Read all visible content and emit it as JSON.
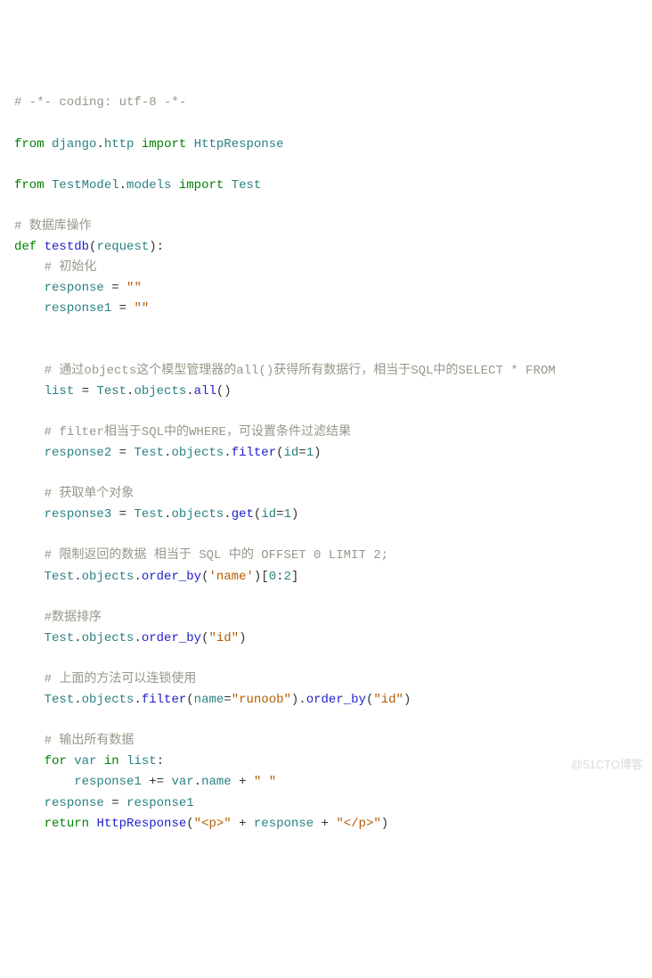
{
  "code": {
    "l1": {
      "c1": "# -*- coding: utf-8 -*-"
    },
    "l3": {
      "kw1": "from",
      "id1": "django",
      "op1": ".",
      "id2": "http",
      "kw2": "import",
      "id3": "HttpResponse"
    },
    "l5": {
      "kw1": "from",
      "id1": "TestModel",
      "op1": ".",
      "id2": "models",
      "kw2": "import",
      "id3": "Test"
    },
    "l7": {
      "c1": "# 数据库操作"
    },
    "l8": {
      "kw1": "def",
      "fn1": "testdb",
      "op1": "(",
      "id1": "request",
      "op2": "):"
    },
    "l9": {
      "c1": "# 初始化"
    },
    "l10": {
      "id1": "response",
      "op1": " = ",
      "str1": "\"\""
    },
    "l11": {
      "id1": "response1",
      "op1": " = ",
      "str1": "\"\""
    },
    "l14": {
      "c1": "# 通过objects这个模型管理器的all()获得所有数据行，相当于SQL中的SELECT * FROM"
    },
    "l15": {
      "id1": "list",
      "op1": " = ",
      "id2": "Test",
      "op2": ".",
      "id3": "objects",
      "op3": ".",
      "fn1": "all",
      "op4": "()"
    },
    "l17": {
      "c1": "# filter相当于SQL中的WHERE，可设置条件过滤结果"
    },
    "l18": {
      "id1": "response2",
      "op1": " = ",
      "id2": "Test",
      "op2": ".",
      "id3": "objects",
      "op3": ".",
      "fn1": "filter",
      "op4": "(",
      "id4": "id",
      "op5": "=",
      "num1": "1",
      "op6": ")"
    },
    "l20": {
      "c1": "# 获取单个对象"
    },
    "l21": {
      "id1": "response3",
      "op1": " = ",
      "id2": "Test",
      "op2": ".",
      "id3": "objects",
      "op3": ".",
      "fn1": "get",
      "op4": "(",
      "id4": "id",
      "op5": "=",
      "num1": "1",
      "op6": ")"
    },
    "l23": {
      "c1": "# 限制返回的数据 相当于 SQL 中的 OFFSET 0 LIMIT 2;"
    },
    "l24": {
      "id1": "Test",
      "op1": ".",
      "id2": "objects",
      "op2": ".",
      "fn1": "order_by",
      "op3": "(",
      "str1": "'name'",
      "op4": ")[",
      "num1": "0",
      "op5": ":",
      "num2": "2",
      "op6": "]"
    },
    "l26": {
      "c1": "#数据排序"
    },
    "l27": {
      "id1": "Test",
      "op1": ".",
      "id2": "objects",
      "op2": ".",
      "fn1": "order_by",
      "op3": "(",
      "str1": "\"id\"",
      "op4": ")"
    },
    "l29": {
      "c1": "# 上面的方法可以连锁使用"
    },
    "l30": {
      "id1": "Test",
      "op1": ".",
      "id2": "objects",
      "op2": ".",
      "fn1": "filter",
      "op3": "(",
      "id3": "name",
      "op4": "=",
      "str1": "\"runoob\"",
      "op5": ").",
      "fn2": "order_by",
      "op6": "(",
      "str2": "\"id\"",
      "op7": ")"
    },
    "l32": {
      "c1": "# 输出所有数据"
    },
    "l33": {
      "kw1": "for",
      "id1": "var",
      "kw2": "in",
      "id2": "list",
      "op1": ":"
    },
    "l34": {
      "id1": "response1",
      "op1": " += ",
      "id2": "var",
      "op2": ".",
      "id3": "name",
      "op3": " + ",
      "str1": "\" \""
    },
    "l35": {
      "id1": "response",
      "op1": " = ",
      "id2": "response1"
    },
    "l36": {
      "kw1": "return",
      "fn1": "HttpResponse",
      "op1": "(",
      "str1": "\"<p>\"",
      "op2": " + ",
      "id1": "response",
      "op3": " + ",
      "str2": "\"</p>\"",
      "op4": ")"
    }
  },
  "watermark": "@51CTO博客"
}
